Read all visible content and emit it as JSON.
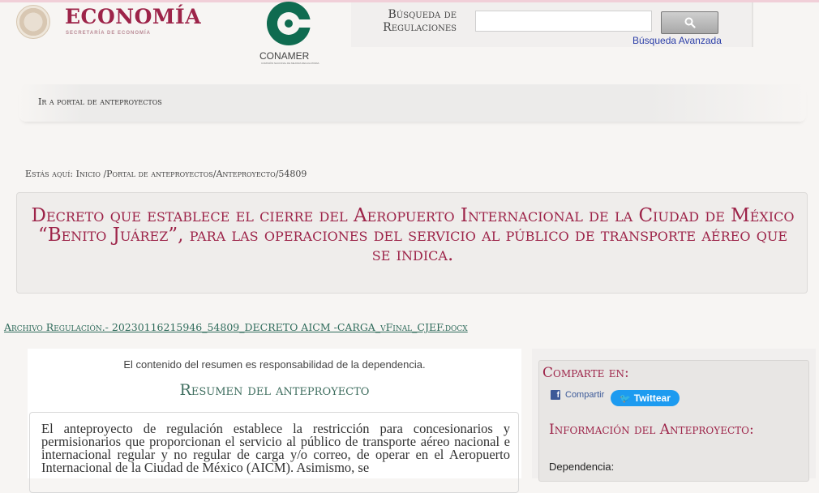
{
  "header": {
    "economia_title": "ECONOMÍA",
    "economia_subtitle": "SECRETARÍA DE ECONOMÍA",
    "conamer_name": "CONAMER",
    "conamer_fullname": "COMISIÓN NACIONAL DE MEJORA REGULATORIA",
    "search_label_line1": "Búsqueda de",
    "search_label_line2": "Regulaciones",
    "search_input_value": "",
    "advanced_search_label": "Búsqueda Avanzada"
  },
  "nav": {
    "portal_link": "Ir a portal de anteproyectos"
  },
  "breadcrumb": "Estás aquí: Inicio /Portal de anteproyectos/Anteproyecto/54809",
  "title": "Decreto que establece el cierre del Aeropuerto Internacional de la Ciudad de México “Benito Juárez”, para las operaciones del servicio al público de transporte aéreo que se indica.",
  "file_link": "Archivo Regulación.- 20230116215946_54809_DECRETO AICM -CARGA_vFinal_CJEF.docx",
  "summary": {
    "disclaimer": "El contenido del resumen es responsabilidad de la dependencia.",
    "heading": "Resumen del anteproyecto",
    "text": "El anteproyecto de regulación establece la restricción para concesionarios y permisionarios que proporcionan el servicio al público de transporte aéreo nacional e internacional regular y no regular de carga y/o correo, de operar en el Aeropuerto Internacional de la Ciudad de México (AICM). Asimismo, se"
  },
  "sidebar": {
    "share_title": "Comparte en:",
    "facebook_label": "Compartir",
    "twitter_label": "Twittear",
    "info_title": "Información del Anteproyecto:",
    "dependencia_label": "Dependencia:"
  },
  "colors": {
    "brand_red": "#9d2449",
    "green": "#3f6e5f",
    "twitter_blue": "#1d9bf0"
  }
}
